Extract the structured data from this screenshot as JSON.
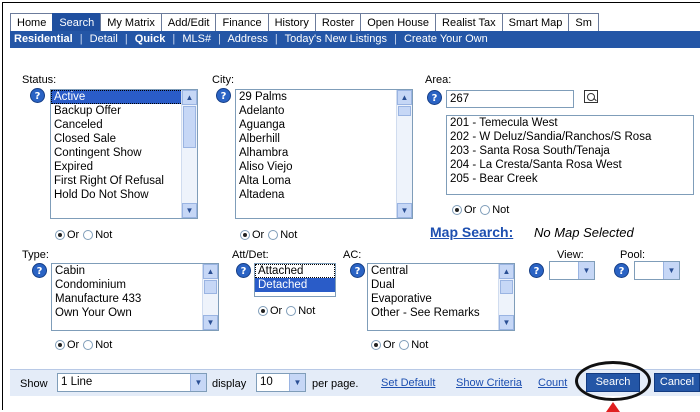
{
  "tabs": [
    {
      "label": "Home",
      "active": false
    },
    {
      "label": "Search",
      "active": true
    },
    {
      "label": "My Matrix",
      "active": false
    },
    {
      "label": "Add/Edit",
      "active": false
    },
    {
      "label": "Finance",
      "active": false
    },
    {
      "label": "History",
      "active": false
    },
    {
      "label": "Roster",
      "active": false
    },
    {
      "label": "Open House",
      "active": false
    },
    {
      "label": "Realist Tax",
      "active": false
    },
    {
      "label": "Smart Map",
      "active": false
    },
    {
      "label": "Sm",
      "active": false
    }
  ],
  "subnav": {
    "items": [
      "Residential",
      "Detail",
      "Quick",
      "MLS#",
      "Address",
      "Today's New Listings",
      "Create Your Own"
    ],
    "sep": "|"
  },
  "status": {
    "label": "Status:",
    "options": [
      "Active",
      "Backup Offer",
      "Canceled",
      "Closed Sale",
      "Contingent Show",
      "Expired",
      "First Right Of Refusal",
      "Hold Do Not Show"
    ],
    "selected": "Active"
  },
  "city": {
    "label": "City:",
    "options": [
      "29 Palms",
      "Adelanto",
      "Aguanga",
      "Alberhill",
      "Alhambra",
      "Aliso Viejo",
      "Alta Loma",
      "Altadena"
    ]
  },
  "area": {
    "label": "Area:",
    "input_value": "267",
    "options": [
      "201 - Temecula West",
      "202 - W Deluz/Sandia/Ranchos/S Rosa",
      "203 - Santa Rosa South/Tenaja",
      "204 - La Cresta/Santa Rosa West",
      "205 - Bear Creek"
    ]
  },
  "type": {
    "label": "Type:",
    "options": [
      "Cabin",
      "Condominium",
      "Manufacture 433",
      "Own Your Own"
    ]
  },
  "attdet": {
    "label": "Att/Det:",
    "options": [
      "Attached",
      "Detached"
    ],
    "selected": "Detached"
  },
  "ac": {
    "label": "AC:",
    "options": [
      "Central",
      "Dual",
      "Evaporative",
      "Other - See Remarks"
    ]
  },
  "view": {
    "label": "View:"
  },
  "pool": {
    "label": "Pool:"
  },
  "radio": {
    "or": "Or",
    "not": "Not"
  },
  "map": {
    "link": "Map Search:",
    "status": "No Map Selected"
  },
  "help_glyph": "?",
  "bottom": {
    "show_label": "Show",
    "show_value": "1 Line",
    "display_label": "display",
    "display_value": "10",
    "per_page": "per page.",
    "set_default": "Set Default",
    "show_criteria": "Show Criteria",
    "count": "Count",
    "search": "Search",
    "cancel": "Cancel"
  },
  "colors": {
    "accent": "#2456a6",
    "highlight_arrow": "#e02020"
  }
}
